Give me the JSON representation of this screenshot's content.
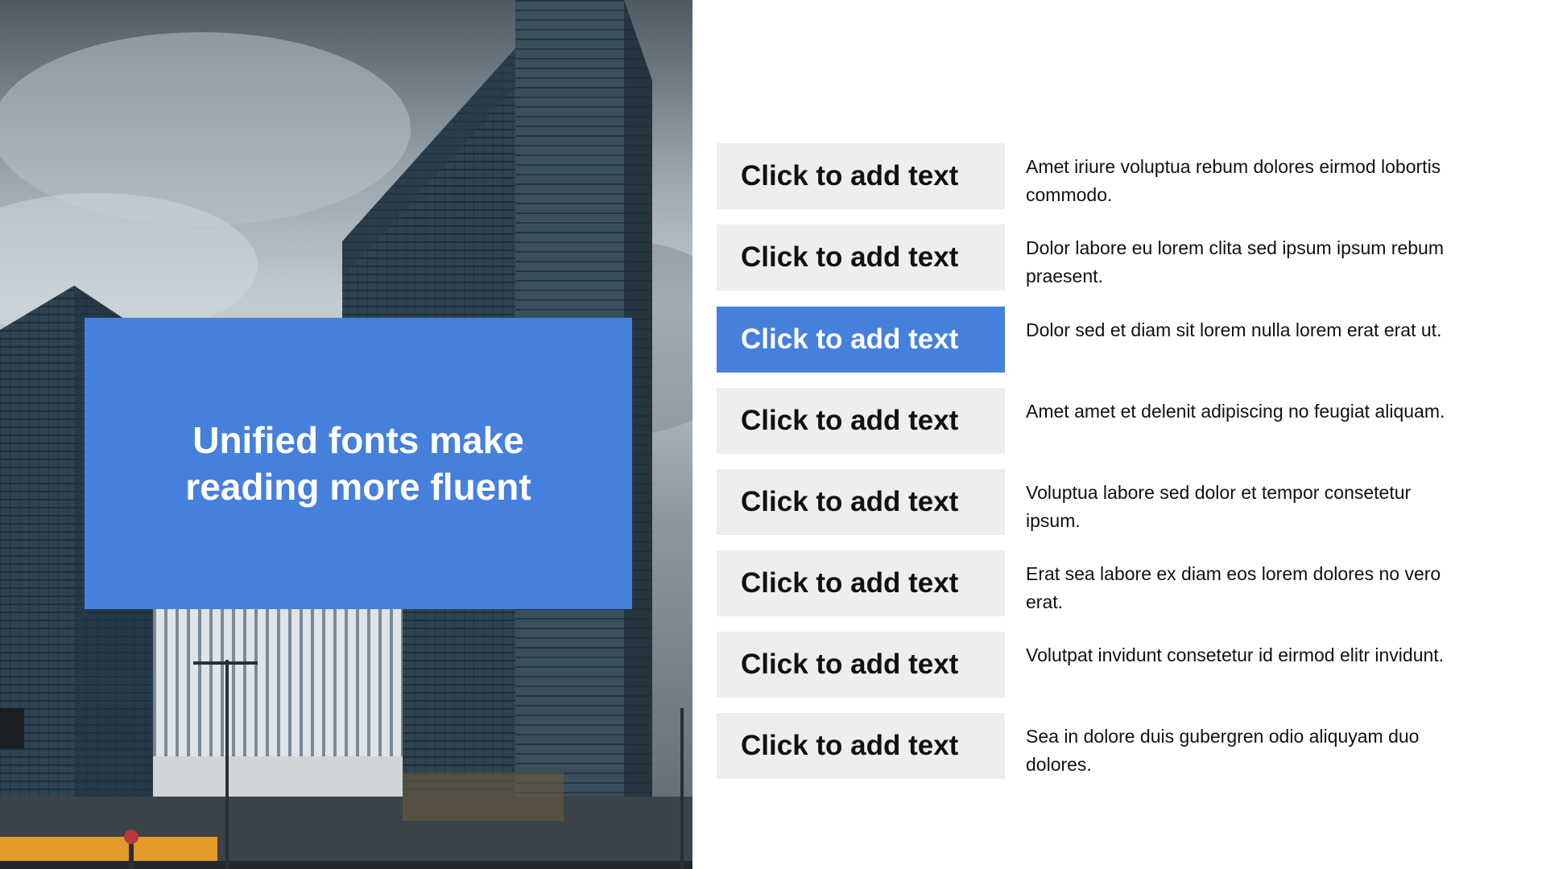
{
  "slide": {
    "title_line1": "Unified fonts make",
    "title_line2": "reading more fluent",
    "photo": {
      "subject": "skyscrapers-photo"
    },
    "accent_color": "#4580dd",
    "item_background": "#eceeef"
  },
  "items": [
    {
      "label": "Click to add text",
      "desc": "Amet iriure voluptua rebum dolores eirmod lobortis commodo.",
      "active": false
    },
    {
      "label": "Click to add text",
      "desc": "Dolor labore eu lorem clita sed ipsum ipsum rebum praesent.",
      "active": false
    },
    {
      "label": "Click to add text",
      "desc": "Dolor sed et diam sit lorem nulla lorem erat erat ut.",
      "active": true
    },
    {
      "label": "Click to add text",
      "desc": "Amet amet et delenit adipiscing no feugiat aliquam.",
      "active": false
    },
    {
      "label": "Click to add text",
      "desc": "Voluptua labore sed dolor et tempor consetetur ipsum.",
      "active": false
    },
    {
      "label": "Click to add text",
      "desc": "Erat sea labore ex diam eos lorem dolores no vero erat.",
      "active": false
    },
    {
      "label": "Click to add text",
      "desc": "Volutpat invidunt consetetur id eirmod elitr invidunt.",
      "active": false
    },
    {
      "label": "Click to add text",
      "desc": "Sea in dolore duis gubergren odio aliquyam duo dolores.",
      "active": false
    }
  ]
}
